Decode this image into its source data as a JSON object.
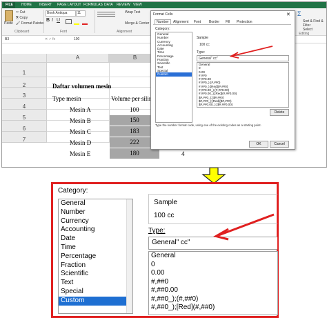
{
  "excel": {
    "menu_tabs": [
      "FILE",
      "HOME",
      "INSERT",
      "PAGE LAYOUT",
      "FORMULAS",
      "DATA",
      "REVIEW",
      "VIEW"
    ],
    "clipboard": {
      "paste": "Paste",
      "cut": "Cut",
      "copy": "Copy",
      "format_painter": "Format Painter",
      "group": "Clipboard"
    },
    "font": {
      "name": "Book Antiqua",
      "size": "11",
      "group": "Font"
    },
    "alignment": {
      "wrap_text": "Wrap Text",
      "merge": "Merge & Center",
      "group": "Alignment"
    },
    "editing": {
      "sort": "Sort & Find &",
      "filter": "Filter",
      "select": "Select",
      "group": "Editing"
    },
    "name_box": "B3",
    "formula_value": "100",
    "col_headers": [
      "A",
      "B"
    ],
    "row_numbers": [
      "1",
      "2",
      "3",
      "4",
      "5",
      "6",
      "7"
    ],
    "title": "Daftar volumen mesin",
    "header_a": "Type mesin",
    "header_b": "Volume per silin",
    "rows": [
      {
        "a": "Mesin A",
        "b": "100"
      },
      {
        "a": "Mesin B",
        "b": "150"
      },
      {
        "a": "Mesin C",
        "b": "183"
      },
      {
        "a": "Mesin D",
        "b": "222"
      },
      {
        "a": "Mesin E",
        "b": "180",
        "c": "4"
      }
    ]
  },
  "dialog": {
    "title": "Format Cells",
    "tabs": [
      "Number",
      "Alignment",
      "Font",
      "Border",
      "Fill",
      "Protection"
    ],
    "category_label": "Category:",
    "categories": [
      "General",
      "Number",
      "Currency",
      "Accounting",
      "Date",
      "Time",
      "Percentage",
      "Fraction",
      "Scientific",
      "Text",
      "Special",
      "Custom"
    ],
    "selected_category": "Custom",
    "sample_label": "Sample",
    "sample_value": "100 cc",
    "type_label": "Type:",
    "type_value": "General\" cc\"",
    "formats": [
      "General",
      "0",
      "0.00",
      "#,##0",
      "#,##0.00",
      "#,##0_);(#,##0)",
      "#,##0_);[Red](#,##0)",
      "#,##0.00_);(#,##0.00)",
      "#,##0.00_);[Red](#,##0.00)",
      "$#,##0_);($#,##0)",
      "$#,##0_);[Red]($#,##0)",
      "$#,##0.00_);($#,##0.00)"
    ],
    "delete_label": "Delete",
    "hint": "Type the number format code, using one of the existing codes as a starting point.",
    "ok_label": "OK",
    "cancel_label": "Cancel"
  },
  "zoom": {
    "category_label": "Category:",
    "categories": [
      "General",
      "Number",
      "Currency",
      "Accounting",
      "Date",
      "Time",
      "Percentage",
      "Fraction",
      "Scientific",
      "Text",
      "Special",
      "Custom"
    ],
    "selected_category": "Custom",
    "sample_label": "Sample",
    "sample_value": "100 cc",
    "type_label": "Type:",
    "type_value": "General\" cc\"",
    "formats": [
      "General",
      "0",
      "0.00",
      "#,##0",
      "#,##0.00",
      "#,##0_);(#,##0)",
      "#,##0_);[Red](#,##0)"
    ]
  },
  "colors": {
    "excel_green": "#217346",
    "highlight_red": "#e02020",
    "arrow_yellow": "#ffff00",
    "selection_blue": "#1e6fd2",
    "cell_gray": "#a6a6a6"
  }
}
